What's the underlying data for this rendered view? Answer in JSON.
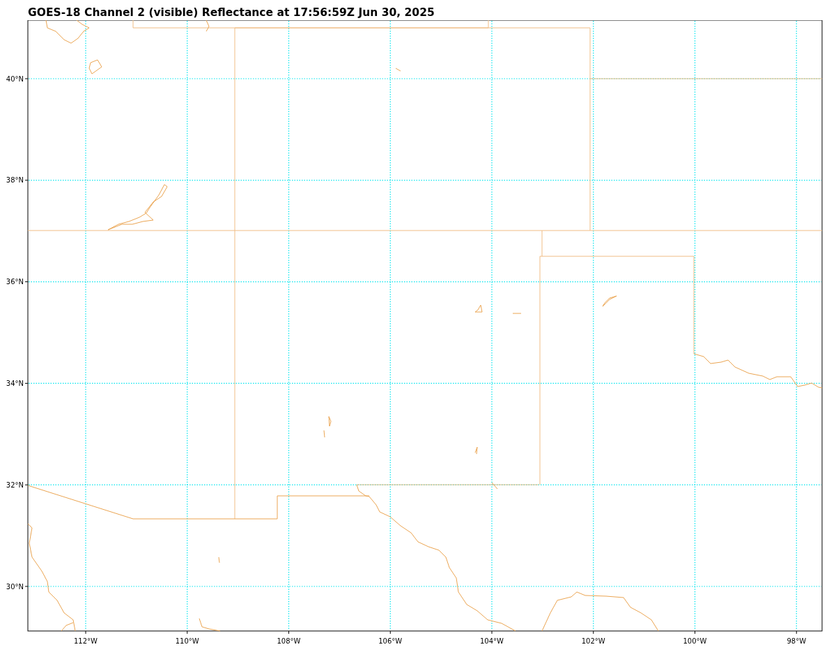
{
  "title": "GOES-18 Channel 2 (visible) Reflectance at 17:56:59Z Jun 30, 2025",
  "map": {
    "x_tick_labels": [
      "112°W",
      "110°W",
      "108°W",
      "106°W",
      "104°W",
      "102°W",
      "100°W",
      "98°W"
    ],
    "y_tick_labels": [
      "40°N",
      "38°N",
      "36°N",
      "34°N",
      "32°N",
      "30°N"
    ]
  }
}
